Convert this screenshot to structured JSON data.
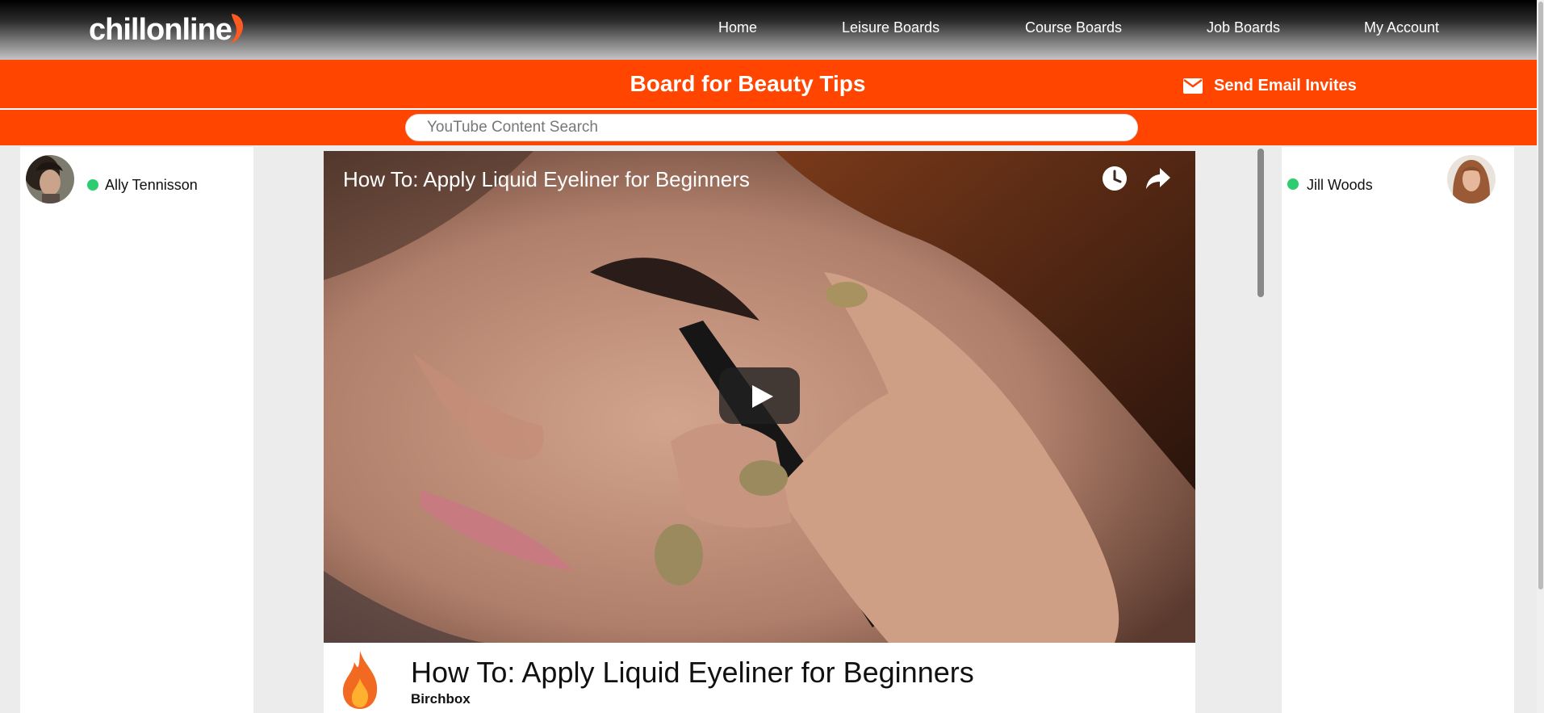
{
  "brand": {
    "logo_text": "chillonline",
    "accent": "#ff4500"
  },
  "nav": {
    "items": [
      {
        "label": "Home"
      },
      {
        "label": "Leisure Boards"
      },
      {
        "label": "Course Boards"
      },
      {
        "label": "Job Boards"
      },
      {
        "label": "My Account"
      }
    ]
  },
  "board": {
    "title": "Board for Beauty Tips",
    "invite_label": "Send Email Invites",
    "invite_icon": "envelope-icon"
  },
  "search": {
    "placeholder": "YouTube Content Search",
    "value": ""
  },
  "users": {
    "left": {
      "name": "Ally Tennisson",
      "status": "online",
      "status_color": "#2ecc71"
    },
    "right": {
      "name": "Jill Woods",
      "status": "online",
      "status_color": "#2ecc71"
    }
  },
  "video": {
    "overlay_title": "How To: Apply Liquid Eyeliner for Beginners",
    "controls": [
      "watch-later-icon",
      "share-icon",
      "play-icon"
    ],
    "info_title": "How To: Apply Liquid Eyeliner for Beginners",
    "channel": "Birchbox",
    "badge_icon": "flame-icon"
  }
}
